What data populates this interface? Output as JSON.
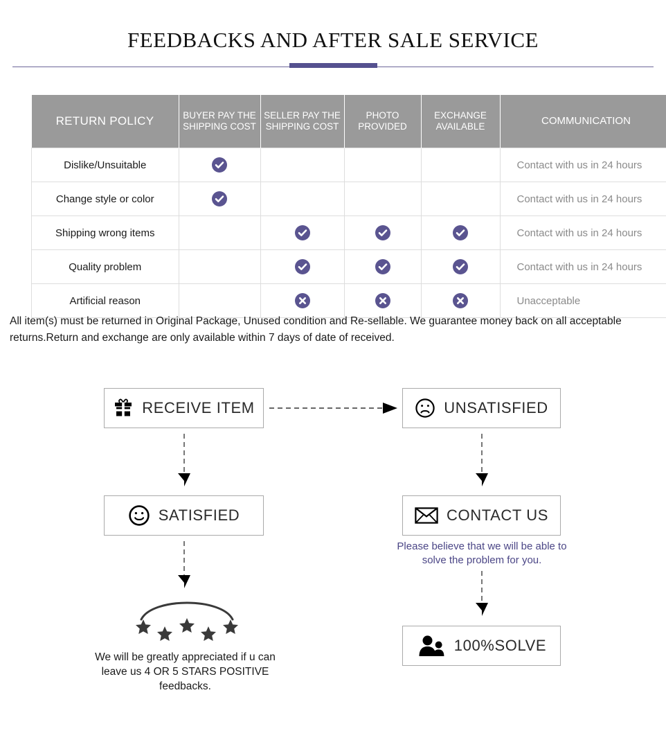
{
  "header": {
    "title": "FEEDBACKS AND AFTER SALE SERVICE",
    "accent_color": "#55518f",
    "rule_color": "#6b6599"
  },
  "table": {
    "columns": [
      "RETURN POLICY",
      "BUYER PAY THE SHIPPING COST",
      "SELLER PAY THE SHIPPING COST",
      "PHOTO PROVIDED",
      "EXCHANGE AVAILABLE",
      "COMMUNICATION"
    ],
    "header_bg": "#9a9a9a",
    "mark_color": "#5a5490",
    "rows": [
      {
        "reason": "Dislike/Unsuitable",
        "buyer_pay": "check",
        "seller_pay": "",
        "photo_provided": "",
        "exchange_available": "",
        "communication": "Contact with us in 24 hours"
      },
      {
        "reason": "Change style or color",
        "buyer_pay": "check",
        "seller_pay": "",
        "photo_provided": "",
        "exchange_available": "",
        "communication": "Contact with us in 24 hours"
      },
      {
        "reason": "Shipping wrong items",
        "buyer_pay": "",
        "seller_pay": "check",
        "photo_provided": "check",
        "exchange_available": "check",
        "communication": "Contact with us in 24 hours"
      },
      {
        "reason": "Quality problem",
        "buyer_pay": "",
        "seller_pay": "check",
        "photo_provided": "check",
        "exchange_available": "check",
        "communication": "Contact with us in 24 hours"
      },
      {
        "reason": "Artificial reason",
        "buyer_pay": "",
        "seller_pay": "cross",
        "photo_provided": "cross",
        "exchange_available": "cross",
        "communication": "Unacceptable"
      }
    ]
  },
  "note": "All item(s) must be returned in Original Package, Unused condition and Re-sellable. We guarantee money back on all acceptable returns.Return and exchange are only available within 7 days of date of received.",
  "flow": {
    "receive_item": "RECEIVE ITEM",
    "unsatisfied": "UNSATISFIED",
    "satisfied": "SATISFIED",
    "contact_us": "CONTACT US",
    "solve": "100%SOLVE",
    "contact_caption": "Please believe that we will be able to solve the problem for you.",
    "stars_caption": "We will be greatly appreciated if u can leave us 4 OR 5 STARS POSITIVE feedbacks.",
    "caption_color": "#4b4686"
  }
}
